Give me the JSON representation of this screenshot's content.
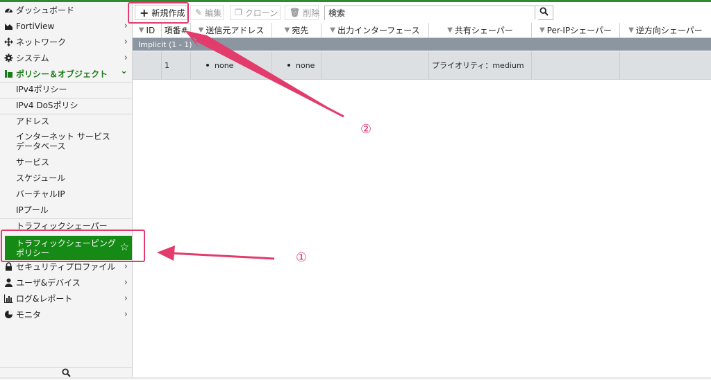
{
  "sidebar": {
    "nav": [
      {
        "label": "ダッシュボード",
        "icon": "dashboard-icon",
        "chevron": ""
      },
      {
        "label": "FortiView",
        "icon": "fortiview-chart-icon",
        "chevron": "›"
      },
      {
        "label": "ネットワーク",
        "icon": "network-arrows-icon",
        "chevron": "›"
      },
      {
        "label": "システム",
        "icon": "gear-icon",
        "chevron": "›"
      },
      {
        "label": "ポリシー＆オブジェクト",
        "icon": "policy-document-icon",
        "chevron": "⌄"
      }
    ],
    "sub_items": [
      "IPv4ポリシー",
      "IPv4 DoSポリシ",
      "アドレス",
      "インターネット サービス\nデータベース",
      "サービス",
      "スケジュール",
      "バーチャルIP",
      "IPプール",
      "トラフィックシェーパー"
    ],
    "selected_item": "トラフィックシェーピング\nポリシー",
    "nav_lower": [
      {
        "label": "セキュリティプロファイル",
        "icon": "lock-icon",
        "chevron": "›"
      },
      {
        "label": "ユーザ&デバイス",
        "icon": "user-icon",
        "chevron": "›"
      },
      {
        "label": "ログ&レポート",
        "icon": "bar-chart-icon",
        "chevron": "›"
      },
      {
        "label": "モニタ",
        "icon": "pie-chart-icon",
        "chevron": "›"
      }
    ]
  },
  "toolbar": {
    "create_label": "新規作成",
    "edit_label": "編集",
    "clone_label": "クローン",
    "delete_label": "削除",
    "search_value": "検索"
  },
  "table": {
    "headers": [
      "ID",
      "項番#",
      "送信元アドレス",
      "宛先",
      "出力インターフェース",
      "共有シェーパー",
      "Per-IPシェーパー",
      "逆方向シェーパー"
    ],
    "group_label": "Implicit (1 - 1)",
    "row": {
      "id": "",
      "seq": "1",
      "src": "none",
      "dst": "none",
      "iface": "",
      "shaper": "プライオリティ：medium",
      "perip": "",
      "reverse": ""
    }
  },
  "annotations": {
    "label_1": "①",
    "label_2": "②",
    "color": "#e23b6c"
  },
  "colors": {
    "accent_green": "#158a15",
    "group_row": "#8c96a0"
  }
}
